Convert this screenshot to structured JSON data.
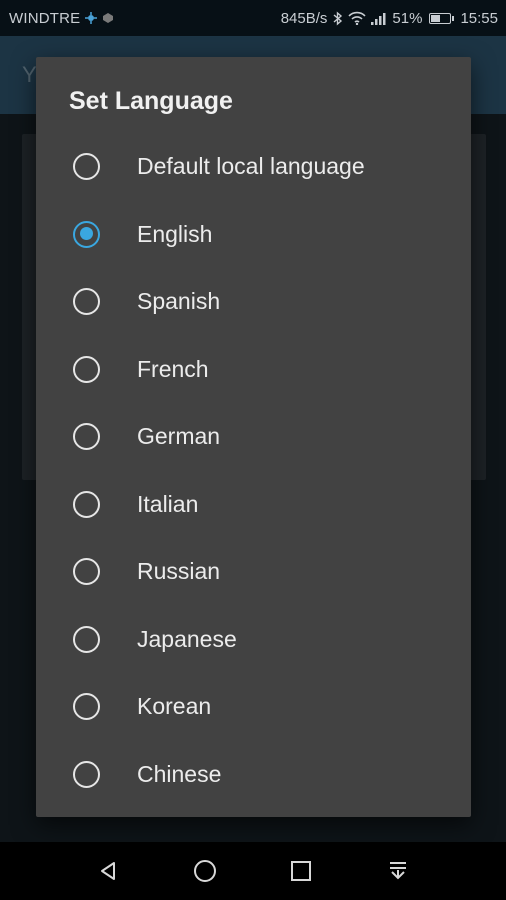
{
  "status_bar": {
    "carrier": "WINDTRE",
    "network_speed": "845B/s",
    "battery_percent": "51%",
    "battery_level": 0.51,
    "time": "15:55",
    "icons": [
      "settings-notification-icon",
      "app-notification-icon",
      "bluetooth-icon",
      "wifi-icon",
      "signal-icon",
      "battery-icon"
    ]
  },
  "app": {
    "toolbar_title": "Y"
  },
  "dialog": {
    "title": "Set Language",
    "selected": "English",
    "options": [
      {
        "label": "Default local language",
        "checked": false
      },
      {
        "label": "English",
        "checked": true
      },
      {
        "label": "Spanish",
        "checked": false
      },
      {
        "label": "French",
        "checked": false
      },
      {
        "label": "German",
        "checked": false
      },
      {
        "label": "Italian",
        "checked": false
      },
      {
        "label": "Russian",
        "checked": false
      },
      {
        "label": "Japanese",
        "checked": false
      },
      {
        "label": "Korean",
        "checked": false
      },
      {
        "label": "Chinese",
        "checked": false
      }
    ]
  },
  "nav_bar": {
    "buttons": [
      "back-icon",
      "home-icon",
      "recents-icon",
      "notification-drawer-icon"
    ]
  },
  "colors": {
    "accent": "#3aa7e0",
    "dialog_bg": "#424242",
    "status_bar_bg": "#071016",
    "toolbar_bg": "#1c3444"
  }
}
